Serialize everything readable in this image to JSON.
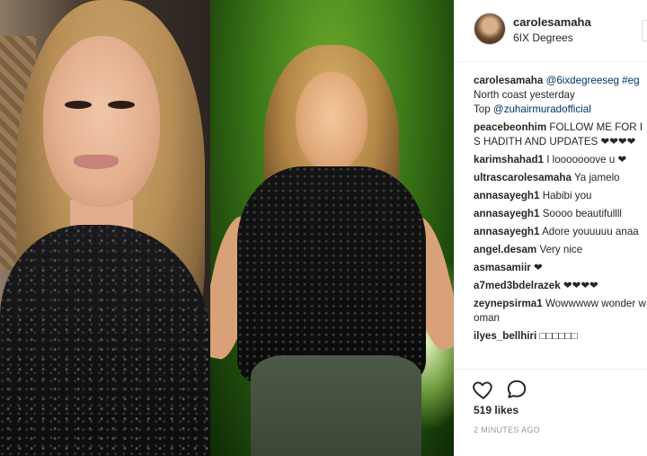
{
  "post": {
    "username": "carolesamaha",
    "location": "6IX Degrees",
    "caption": {
      "user": "carolesamaha",
      "line1_mention": "@6ixdegreeseg #eg",
      "line2": "North coast yesterday",
      "line3_prefix": "Top ",
      "line3_mention": "@zuhairmuradofficial"
    },
    "comments": [
      {
        "user": "peacebeonhim",
        "text": "FOLLOW ME FOR IS HADITH AND UPDATES ❤❤❤❤"
      },
      {
        "user": "karimshahad1",
        "text": "I looooooove u ❤"
      },
      {
        "user": "ultrascarolesamaha",
        "text": "Ya jamelo"
      },
      {
        "user": "annasayegh1",
        "text": "Habibi you"
      },
      {
        "user": "annasayegh1",
        "text": "Soooo beautifullll"
      },
      {
        "user": "annasayegh1",
        "text": "Adore youuuuu anaa"
      },
      {
        "user": "angel.desam",
        "text": "Very nice"
      },
      {
        "user": "asmasamiir",
        "text": "❤"
      },
      {
        "user": "a7med3bdelrazek",
        "text": "❤❤❤❤"
      },
      {
        "user": "zeynepsirma1",
        "text": "Wowwwww wonder woman"
      },
      {
        "user": "ilyes_bellhiri",
        "text": "□□□□□□"
      }
    ],
    "likes": "519 likes",
    "timestamp": "2 MINUTES AGO"
  },
  "icons": {
    "like": "heart-icon",
    "comment": "comment-bubble-icon"
  }
}
